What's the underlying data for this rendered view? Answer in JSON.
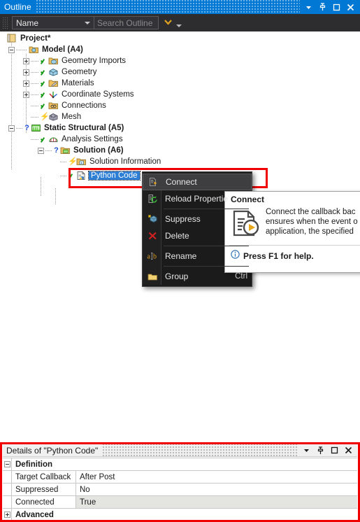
{
  "outline_panel": {
    "title": "Outline",
    "window_buttons": [
      {
        "name": "dropdown-icon",
        "glyph": "▾"
      },
      {
        "name": "pin-icon",
        "glyph": "pin"
      },
      {
        "name": "maximize-icon",
        "glyph": "□"
      },
      {
        "name": "close-icon",
        "glyph": "✕"
      }
    ],
    "toolbar": {
      "filter_combo_value": "Name",
      "search_placeholder": "Search Outline",
      "expand_chevron": "chevron-double-down",
      "overflow_arrow": "overflow-arrow"
    }
  },
  "tree": {
    "nodes": [
      {
        "label": "Project*",
        "depth": 0,
        "icon": "project-icon",
        "bold": true,
        "expander": "none",
        "status": "none"
      },
      {
        "label": "Model (A4)",
        "depth": 1,
        "icon": "model-icon",
        "bold": true,
        "expander": "minus",
        "status": "none"
      },
      {
        "label": "Geometry Imports",
        "depth": 2,
        "icon": "geometry-imports-icon",
        "bold": false,
        "expander": "plus",
        "status": "check"
      },
      {
        "label": "Geometry",
        "depth": 2,
        "icon": "geometry-icon",
        "bold": false,
        "expander": "plus",
        "status": "check"
      },
      {
        "label": "Materials",
        "depth": 2,
        "icon": "materials-icon",
        "bold": false,
        "expander": "plus",
        "status": "check"
      },
      {
        "label": "Coordinate Systems",
        "depth": 2,
        "icon": "coordinate-systems-icon",
        "bold": false,
        "expander": "plus",
        "status": "check"
      },
      {
        "label": "Connections",
        "depth": 2,
        "icon": "connections-icon",
        "bold": false,
        "expander": "none",
        "status": "check"
      },
      {
        "label": "Mesh",
        "depth": 2,
        "icon": "mesh-icon",
        "bold": false,
        "expander": "none",
        "status": "bolt"
      },
      {
        "label": "Static Structural (A5)",
        "depth": 1,
        "icon": "static-structural-icon",
        "bold": true,
        "expander": "minus",
        "status": "question"
      },
      {
        "label": "Analysis Settings",
        "depth": 2,
        "icon": "analysis-settings-icon",
        "bold": false,
        "expander": "none",
        "status": "check"
      },
      {
        "label": "Solution (A6)",
        "depth": 2,
        "icon": "solution-icon",
        "bold": true,
        "expander": "minus",
        "status": "question"
      },
      {
        "label": "Solution Information",
        "depth": 3,
        "icon": "solution-information-icon",
        "bold": false,
        "expander": "none",
        "status": "bolt"
      },
      {
        "label": "Python Code",
        "depth": 3,
        "icon": "python-code-icon",
        "bold": false,
        "expander": "none",
        "status": "check",
        "selected": true
      }
    ]
  },
  "context_menu": {
    "items": [
      {
        "label": "Connect",
        "icon": "connect-icon",
        "accel": "",
        "highlighted": true,
        "separator_after": false
      },
      {
        "label": "Reload Propertie",
        "icon": "reload-properties-icon",
        "accel": "",
        "highlighted": false,
        "separator_after": true
      },
      {
        "label": "Suppress",
        "icon": "suppress-icon",
        "accel": "",
        "highlighted": false,
        "separator_after": false
      },
      {
        "label": "Delete",
        "icon": "delete-icon",
        "accel": "",
        "highlighted": false,
        "separator_after": true
      },
      {
        "label": "Rename",
        "icon": "rename-icon",
        "accel": "",
        "highlighted": false,
        "separator_after": true
      },
      {
        "label": "Group",
        "icon": "group-icon",
        "accel": "Ctrl",
        "highlighted": false,
        "separator_after": false
      }
    ]
  },
  "tooltip": {
    "title": "Connect",
    "icon": "connect-document-play-icon",
    "lines": [
      "Connect the callback bac",
      "ensures when the event o",
      "application, the specified"
    ],
    "help_icon": "info-icon",
    "help_text": "Press F1 for help."
  },
  "cursor": {
    "name": "mouse-pointer"
  },
  "details_panel": {
    "title": "Details of \"Python Code\"",
    "window_buttons": [
      {
        "name": "dropdown-icon",
        "glyph": "▾"
      },
      {
        "name": "pin-icon",
        "glyph": "pin"
      },
      {
        "name": "maximize-icon",
        "glyph": "□"
      },
      {
        "name": "close-icon",
        "glyph": "✕"
      }
    ],
    "rows": [
      {
        "type": "section",
        "expander": "minus",
        "label": "Definition"
      },
      {
        "type": "property",
        "name": "Target Callback",
        "value": "After Post",
        "readonly": false
      },
      {
        "type": "property",
        "name": "Suppressed",
        "value": "No",
        "readonly": false
      },
      {
        "type": "property",
        "name": "Connected",
        "value": "True",
        "readonly": true
      },
      {
        "type": "section",
        "expander": "plus",
        "label": "Advanced"
      }
    ]
  },
  "colors": {
    "title_bar": "#0078d4",
    "toolbar_bg": "#2d2d30",
    "menu_bg": "#1b1b1c",
    "menu_hover": "#3e3e40",
    "annotation_red": "#f00000",
    "selection_blue": "#2d7fd6",
    "check_green": "#1a9a1a",
    "readonly_gray": "#e4e4e0"
  }
}
